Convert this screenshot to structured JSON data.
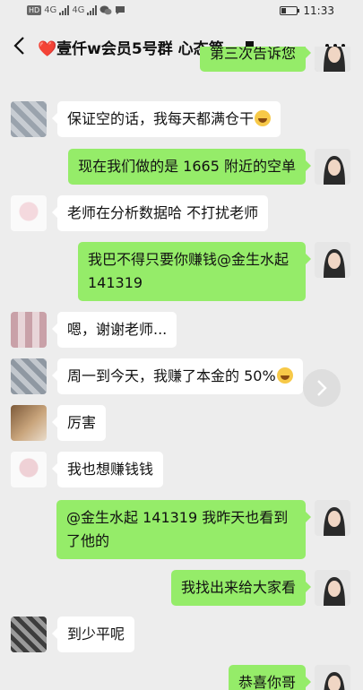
{
  "status_bar": {
    "badge": "HD",
    "net1": "4G",
    "net2": "4G",
    "time": "11:33",
    "battery_level": 0.3
  },
  "header": {
    "title": "❤️壹仟w会员5号群 心态第-"
  },
  "messages": [
    {
      "side": "out",
      "text": "第三次告诉您",
      "avatar": "woman-portrait"
    },
    {
      "side": "in",
      "text": "保证空的话，我每天都满仓干",
      "emoji": "money-face",
      "avatar": "blurred"
    },
    {
      "side": "out",
      "text": "现在我们做的是 1665 附近的空单",
      "avatar": "woman-portrait"
    },
    {
      "side": "in",
      "text": "老师在分析数据哈   不打扰老师",
      "avatar": "blurred-pink"
    },
    {
      "side": "out",
      "line1": "我巴不得只要你赚钱@金生水起",
      "line2": "141319",
      "avatar": "woman-portrait"
    },
    {
      "side": "in",
      "text": "嗯，谢谢老师...",
      "avatar": "blurred-mosaic"
    },
    {
      "side": "in",
      "text": "周一到今天，我赚了本金的 50%",
      "emoji": "grin",
      "avatar": "blurred"
    },
    {
      "side": "in",
      "text": "厉害",
      "avatar": "blurred-brown"
    },
    {
      "side": "in",
      "text": "我也想赚钱钱",
      "avatar": "blurred-pink"
    },
    {
      "side": "out",
      "line1": "@金生水起 141319  我昨天也看到",
      "line2": "了他的",
      "avatar": "woman-portrait"
    },
    {
      "side": "out",
      "text": "我找出来给大家看",
      "avatar": "woman-portrait"
    },
    {
      "side": "in",
      "text": "到少平呢",
      "avatar": "blurred-dark"
    },
    {
      "side": "out",
      "text": "恭喜你哥",
      "avatar": "woman-portrait"
    }
  ],
  "icons": {
    "back": "chevron-left-icon",
    "more": "more-dots-icon",
    "forward": "chevron-right-icon"
  },
  "colors": {
    "background": "#ededed",
    "outgoing_bubble": "#95ec69",
    "incoming_bubble": "#ffffff"
  }
}
